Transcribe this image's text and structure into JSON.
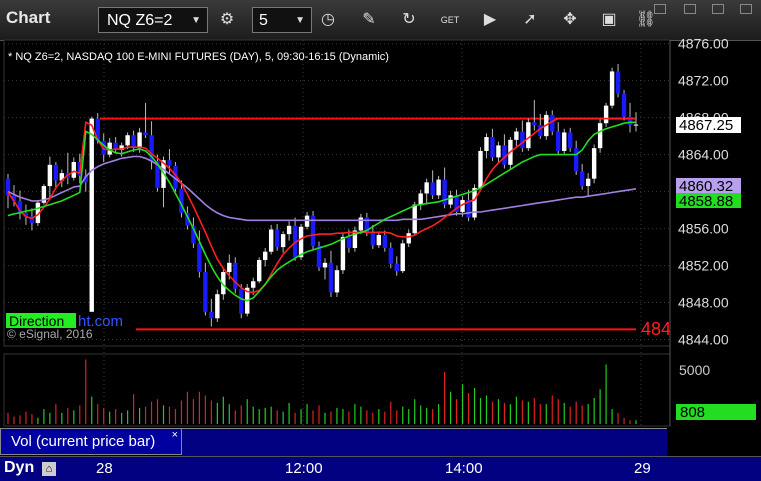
{
  "window": {
    "title": "Chart"
  },
  "toolbar": {
    "symbol": "NQ Z6=2",
    "interval": "5",
    "icons": [
      "settings-gear-icon",
      "clock-icon",
      "pencil-icon",
      "refresh-icon",
      "get-icon",
      "play-icon",
      "cursor-icon",
      "comment-icon",
      "link-icon"
    ]
  },
  "chart_header": "* NQ Z6=2, NASDAQ 100 E-MINI FUTURES (DAY), 5, 09:30-16:15 (Dynamic)",
  "watermark": {
    "prefix": "Direction",
    "suffix": "ht.com",
    "copyright": "© eSignal, 2016"
  },
  "price_labels": {
    "last": "4867.25",
    "ma_purple": "4860.32",
    "ma_green": "4858.88",
    "red_level_cut": "484"
  },
  "volume_labels": {
    "axis_top": "5000",
    "current": "808",
    "panel_title": "Vol (current price bar)",
    "close": "×"
  },
  "status": {
    "mode": "Dyn"
  },
  "time_labels": [
    "28",
    "12:00",
    "14:00",
    "29"
  ],
  "colors": {
    "up": "#ffffff",
    "down": "#1a1aff",
    "ma_red": "#ff2020",
    "ma_purple": "#a080e0",
    "ma_green": "#22dd22",
    "level_red": "#ff1010"
  },
  "chart_data": {
    "type": "candlestick",
    "y_axis_ticks": [
      "4876.00",
      "4872.00",
      "4868.00",
      "4864.00",
      "4860.00",
      "4856.00",
      "4852.00",
      "4848.00",
      "4844.00"
    ],
    "ylim": [
      4843.3,
      4876.4
    ],
    "reference_lines": [
      4867.9,
      4845.1
    ],
    "candles": [
      [
        4861.4,
        4861.9,
        4858.2,
        4859.6
      ],
      [
        4859.6,
        4860.7,
        4858.4,
        4859.0
      ],
      [
        4859.0,
        4860.1,
        4857.0,
        4857.7
      ],
      [
        4857.7,
        4858.6,
        4856.4,
        4857.3
      ],
      [
        4857.3,
        4858.2,
        4855.8,
        4856.6
      ],
      [
        4856.6,
        4859.1,
        4856.3,
        4858.8
      ],
      [
        4858.8,
        4860.8,
        4858.6,
        4860.6
      ],
      [
        4860.6,
        4863.8,
        4859.3,
        4862.9
      ],
      [
        4862.9,
        4863.2,
        4860.3,
        4861.2
      ],
      [
        4861.2,
        4862.4,
        4860.5,
        4862.0
      ],
      [
        4862.0,
        4864.2,
        4860.8,
        4861.5
      ],
      [
        4861.5,
        4863.7,
        4861.2,
        4863.2
      ],
      [
        4863.2,
        4864.1,
        4860.9,
        4861.7
      ],
      [
        4861.7,
        4862.4,
        4860.0,
        4861.0
      ],
      [
        4847.0,
        4868.1,
        4847.0,
        4867.9
      ],
      [
        4867.9,
        4868.5,
        4865.2,
        4865.5
      ],
      [
        4865.5,
        4866.3,
        4863.2,
        4864.0
      ],
      [
        4864.0,
        4865.8,
        4863.7,
        4865.3
      ],
      [
        4865.3,
        4865.9,
        4864.1,
        4864.5
      ],
      [
        4864.5,
        4865.3,
        4863.8,
        4865.0
      ],
      [
        4865.0,
        4866.4,
        4864.6,
        4866.1
      ],
      [
        4866.1,
        4866.6,
        4864.3,
        4864.7
      ],
      [
        4864.7,
        4866.9,
        4864.2,
        4866.4
      ],
      [
        4866.4,
        4869.6,
        4865.8,
        4866.1
      ],
      [
        4866.1,
        4867.6,
        4862.4,
        4863.3
      ],
      [
        4863.3,
        4864.0,
        4860.0,
        4860.4
      ],
      [
        4860.4,
        4863.8,
        4858.3,
        4863.4
      ],
      [
        4863.4,
        4864.6,
        4862.0,
        4862.8
      ],
      [
        4862.8,
        4863.2,
        4860.0,
        4860.3
      ],
      [
        4860.3,
        4861.2,
        4857.2,
        4857.7
      ],
      [
        4857.7,
        4858.4,
        4855.9,
        4856.3
      ],
      [
        4856.3,
        4857.2,
        4853.9,
        4854.4
      ],
      [
        4854.4,
        4855.8,
        4850.7,
        4851.3
      ],
      [
        4851.3,
        4852.3,
        4846.6,
        4847.0
      ],
      [
        4847.0,
        4848.4,
        4845.4,
        4846.3
      ],
      [
        4846.3,
        4849.4,
        4845.9,
        4848.9
      ],
      [
        4848.9,
        4851.8,
        4848.3,
        4851.3
      ],
      [
        4851.3,
        4853.2,
        4850.5,
        4852.3
      ],
      [
        4852.3,
        4852.9,
        4849.0,
        4849.5
      ],
      [
        4849.5,
        4850.0,
        4846.3,
        4846.8
      ],
      [
        4846.8,
        4850.0,
        4846.5,
        4849.6
      ],
      [
        4849.6,
        4850.7,
        4848.8,
        4850.3
      ],
      [
        4850.3,
        4852.9,
        4850.1,
        4852.6
      ],
      [
        4852.6,
        4853.9,
        4851.9,
        4853.5
      ],
      [
        4853.5,
        4856.4,
        4853.2,
        4855.9
      ],
      [
        4855.9,
        4856.5,
        4853.6,
        4854.0
      ],
      [
        4854.0,
        4855.7,
        4853.4,
        4855.4
      ],
      [
        4855.4,
        4856.8,
        4854.7,
        4856.3
      ],
      [
        4856.3,
        4857.2,
        4852.5,
        4852.9
      ],
      [
        4852.9,
        4856.5,
        4852.6,
        4856.2
      ],
      [
        4856.2,
        4857.8,
        4855.9,
        4857.4
      ],
      [
        4857.4,
        4857.9,
        4853.7,
        4854.1
      ],
      [
        4854.1,
        4854.6,
        4851.4,
        4851.8
      ],
      [
        4851.8,
        4852.8,
        4850.5,
        4852.3
      ],
      [
        4852.3,
        4853.6,
        4848.6,
        4849.1
      ],
      [
        4849.1,
        4852.0,
        4848.6,
        4851.5
      ],
      [
        4851.5,
        4855.6,
        4851.1,
        4855.1
      ],
      [
        4855.1,
        4855.9,
        4853.4,
        4853.9
      ],
      [
        4853.9,
        4856.2,
        4853.5,
        4855.8
      ],
      [
        4855.8,
        4857.6,
        4855.4,
        4857.2
      ],
      [
        4857.2,
        4857.7,
        4855.2,
        4855.6
      ],
      [
        4855.6,
        4856.4,
        4853.8,
        4854.2
      ],
      [
        4854.2,
        4855.7,
        4853.9,
        4855.3
      ],
      [
        4855.3,
        4855.8,
        4853.5,
        4853.9
      ],
      [
        4853.9,
        4854.5,
        4851.7,
        4852.2
      ],
      [
        4852.2,
        4853.0,
        4850.9,
        4851.4
      ],
      [
        4851.4,
        4854.8,
        4851.2,
        4854.4
      ],
      [
        4854.4,
        4855.9,
        4854.0,
        4855.5
      ],
      [
        4855.5,
        4858.9,
        4855.2,
        4858.6
      ],
      [
        4858.6,
        4860.2,
        4858.0,
        4859.8
      ],
      [
        4859.8,
        4861.4,
        4858.6,
        4861.0
      ],
      [
        4861.0,
        4862.3,
        4859.2,
        4859.6
      ],
      [
        4859.6,
        4861.7,
        4859.2,
        4861.3
      ],
      [
        4861.3,
        4862.6,
        4858.2,
        4858.6
      ],
      [
        4858.6,
        4860.1,
        4858.2,
        4859.6
      ],
      [
        4859.6,
        4860.2,
        4857.4,
        4857.8
      ],
      [
        4857.8,
        4859.5,
        4857.3,
        4859.1
      ],
      [
        4859.1,
        4860.2,
        4856.8,
        4857.2
      ],
      [
        4857.2,
        4860.8,
        4856.9,
        4860.4
      ],
      [
        4860.4,
        4864.8,
        4860.1,
        4864.4
      ],
      [
        4864.4,
        4866.3,
        4863.6,
        4865.9
      ],
      [
        4865.9,
        4866.8,
        4863.3,
        4863.7
      ],
      [
        4863.7,
        4865.4,
        4863.2,
        4865.0
      ],
      [
        4865.0,
        4866.2,
        4862.5,
        4862.9
      ],
      [
        4862.9,
        4865.9,
        4862.4,
        4865.6
      ],
      [
        4865.6,
        4866.9,
        4864.9,
        4866.5
      ],
      [
        4866.5,
        4867.7,
        4864.3,
        4864.7
      ],
      [
        4864.7,
        4867.9,
        4864.4,
        4867.5
      ],
      [
        4867.5,
        4869.9,
        4866.6,
        4867.2
      ],
      [
        4867.2,
        4868.4,
        4865.7,
        4866.0
      ],
      [
        4866.0,
        4868.7,
        4865.6,
        4868.3
      ],
      [
        4868.3,
        4868.8,
        4866.1,
        4866.5
      ],
      [
        4866.5,
        4867.5,
        4864.0,
        4864.4
      ],
      [
        4864.4,
        4866.8,
        4864.1,
        4866.4
      ],
      [
        4866.4,
        4866.9,
        4864.3,
        4864.7
      ],
      [
        4864.7,
        4865.5,
        4861.8,
        4862.2
      ],
      [
        4862.2,
        4863.0,
        4860.2,
        4860.6
      ],
      [
        4860.6,
        4862.0,
        4859.5,
        4861.4
      ],
      [
        4861.4,
        4865.1,
        4860.9,
        4864.7
      ],
      [
        4864.7,
        4867.8,
        4864.2,
        4867.4
      ],
      [
        4867.4,
        4869.6,
        4867.0,
        4869.3
      ],
      [
        4869.3,
        4873.4,
        4869.0,
        4873.0
      ],
      [
        4873.0,
        4873.8,
        4870.2,
        4870.6
      ],
      [
        4870.6,
        4871.0,
        4867.7,
        4868.1
      ],
      [
        4868.1,
        4869.6,
        4866.4,
        4867.2
      ],
      [
        4867.2,
        4868.6,
        4866.5,
        4867.25
      ]
    ],
    "moving_averages": {
      "red": [
        4859.9,
        4859.0,
        4857.9,
        4857.3,
        4857.1,
        4857.5,
        4858.3,
        4859.2,
        4860.4,
        4861.2,
        4861.8,
        4862.2,
        4862.0,
        4867.5,
        4867.2,
        4865.6,
        4864.6,
        4864.5,
        4864.6,
        4864.6,
        4864.8,
        4864.8,
        4864.8,
        4864.7,
        4864.1,
        4863.6,
        4863.1,
        4862.5,
        4861.8,
        4860.9,
        4859.7,
        4858.4,
        4857.0,
        4855.6,
        4854.1,
        4852.7,
        4851.7,
        4850.9,
        4850.2,
        4849.6,
        4849.2,
        4849.1,
        4849.3,
        4849.9,
        4851.1,
        4852.2,
        4853.2,
        4853.9,
        4854.5,
        4854.9,
        4855.2,
        4855.3,
        4855.4,
        4855.4,
        4855.4,
        4855.5,
        4855.5,
        4855.6,
        4855.6,
        4855.6,
        4855.6,
        4855.6,
        4855.6,
        4855.6,
        4855.5,
        4855.2,
        4855.1,
        4855.1,
        4855.3,
        4855.7,
        4856.0,
        4856.3,
        4856.7,
        4857.2,
        4857.7,
        4858.2,
        4858.6,
        4858.9,
        4859.1,
        4860.2,
        4861.4,
        4862.4,
        4863.1,
        4863.7,
        4864.3,
        4864.8,
        4865.3,
        4865.8,
        4866.3,
        4866.8,
        4867.2,
        4867.6,
        4867.9,
        4867.9,
        4867.9,
        4867.9,
        4867.9,
        4867.9,
        4867.9,
        4867.9,
        4867.9,
        4867.9,
        4867.9,
        4867.9,
        4867.9,
        4867.9
      ],
      "purple": [
        4860.0,
        4859.7,
        4859.4,
        4859.2,
        4859.0,
        4859.0,
        4859.1,
        4859.3,
        4859.6,
        4859.9,
        4860.2,
        4860.5,
        4860.6,
        4861.6,
        4862.3,
        4862.7,
        4863.0,
        4863.2,
        4863.4,
        4863.6,
        4863.7,
        4863.8,
        4863.8,
        4863.6,
        4863.3,
        4862.9,
        4862.4,
        4861.9,
        4861.4,
        4860.9,
        4860.4,
        4859.8,
        4859.2,
        4858.6,
        4858.1,
        4857.7,
        4857.4,
        4857.2,
        4857.1,
        4857.0,
        4856.9,
        4856.9,
        4856.9,
        4856.9,
        4856.9,
        4856.9,
        4856.9,
        4856.9,
        4856.9,
        4856.9,
        4856.9,
        4856.9,
        4856.9,
        4856.9,
        4856.9,
        4856.9,
        4856.9,
        4856.9,
        4856.9,
        4856.9,
        4856.9,
        4856.9,
        4856.9,
        4856.9,
        4856.9,
        4856.9,
        4857.0,
        4857.0,
        4857.0,
        4857.0,
        4857.1,
        4857.2,
        4857.3,
        4857.4,
        4857.5,
        4857.6,
        4857.6,
        4857.7,
        4857.8,
        4857.8,
        4857.9,
        4858.0,
        4858.1,
        4858.2,
        4858.3,
        4858.4,
        4858.5,
        4858.6,
        4858.7,
        4858.8,
        4858.9,
        4859.0,
        4859.1,
        4859.2,
        4859.3,
        4859.4,
        4859.4,
        4859.5,
        4859.6,
        4859.7,
        4859.8,
        4859.9,
        4860.0,
        4860.1,
        4860.2,
        4860.3
      ],
      "green": [
        4857.4,
        4857.6,
        4857.7,
        4857.9,
        4858.0,
        4858.2,
        4858.4,
        4858.6,
        4858.8,
        4859.0,
        4859.3,
        4859.6,
        4859.9,
        4866.5,
        4866.2,
        4865.6,
        4865.0,
        4864.5,
        4864.2,
        4864.1,
        4864.3,
        4864.5,
        4864.6,
        4864.4,
        4863.8,
        4863.0,
        4862.0,
        4861.0,
        4859.8,
        4858.6,
        4857.3,
        4856.0,
        4854.6,
        4853.2,
        4851.9,
        4850.8,
        4849.9,
        4849.3,
        4848.8,
        4848.4,
        4848.2,
        4848.5,
        4849.2,
        4850.0,
        4850.8,
        4851.5,
        4852.0,
        4852.4,
        4852.8,
        4853.2,
        4853.5,
        4853.7,
        4853.9,
        4854.1,
        4854.3,
        4854.6,
        4854.9,
        4855.2,
        4855.4,
        4855.6,
        4855.8,
        4856.2,
        4856.6,
        4857.0,
        4857.3,
        4857.6,
        4857.9,
        4858.2,
        4858.5,
        4858.6,
        4858.7,
        4858.8,
        4858.9,
        4859.1,
        4859.3,
        4859.5,
        4859.7,
        4859.9,
        4860.1,
        4860.4,
        4860.8,
        4861.2,
        4861.6,
        4862.0,
        4862.4,
        4862.8,
        4863.2,
        4863.5,
        4863.8,
        4864.0,
        4864.0,
        4864.0,
        4864.0,
        4864.0,
        4864.0,
        4864.0,
        4864.5,
        4865.5,
        4866.2,
        4866.5,
        4866.8,
        4867.0,
        4867.2,
        4867.4,
        4867.5,
        4867.5
      ]
    },
    "volume": {
      "ylim": [
        0,
        5000
      ],
      "bars": [
        900,
        600,
        700,
        1000,
        800,
        500,
        1200,
        900,
        1600,
        900,
        1300,
        1100,
        1500,
        5200,
        2200,
        1600,
        1300,
        1000,
        1200,
        900,
        1100,
        2400,
        1300,
        1400,
        1800,
        2000,
        1500,
        1400,
        1200,
        1900,
        2600,
        2000,
        2600,
        2300,
        1900,
        1700,
        2200,
        1600,
        1100,
        1500,
        2000,
        1400,
        1200,
        1300,
        1400,
        1100,
        1000,
        1700,
        900,
        1200,
        1600,
        1100,
        1500,
        900,
        1000,
        1300,
        1200,
        1000,
        1600,
        1400,
        1100,
        900,
        1200,
        1000,
        1800,
        1100,
        1400,
        1200,
        2000,
        1500,
        1300,
        1200,
        1600,
        4200,
        2600,
        2000,
        3200,
        2500,
        2900,
        2100,
        2300,
        1800,
        2000,
        1700,
        1600,
        2200,
        1900,
        1800,
        2100,
        1600,
        1600,
        2300,
        2000,
        1700,
        1400,
        1800,
        1500,
        1600,
        2100,
        2800,
        4800,
        1200,
        900,
        500,
        300,
        300
      ]
    }
  }
}
